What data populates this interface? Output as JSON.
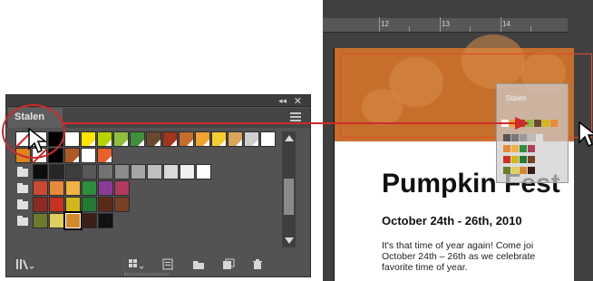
{
  "left_panel": {
    "tab_label": "Stalen",
    "collapse_glyph": "◂◂",
    "close_glyph": "✕",
    "swatch_rows": [
      {
        "folder": false,
        "swatches": [
          "none",
          "#ffffff",
          "#000000",
          "#ffffff|glob",
          "#ffe400|glob",
          "#b7d300|glob",
          "#8dbf3d|glob",
          "#3f8f3d|glob",
          "#6a4a2f|glob",
          "#a0341d|glob",
          "#c76c2c|glob",
          "#f0a32f|glob",
          "#f5cf2f|glob",
          "#d9a55a|glob",
          "#cfcfcf|glob",
          "#ffffff|glob"
        ]
      },
      {
        "folder": false,
        "swatches": [
          "#e0821f",
          "#ffffff|none",
          "#000000",
          "#b05a23|glob",
          "#ffffff|glob",
          "#e85f2c|glob"
        ]
      },
      {
        "folder": true,
        "swatches": [
          "#0d0d0d",
          "#262626",
          "#3f3f3f",
          "#595959",
          "#737373",
          "#8c8c8c",
          "#a6a6a6",
          "#bfbfbf",
          "#d9d9d9",
          "#efefef",
          "#ffffff"
        ]
      },
      {
        "folder": true,
        "swatches": [
          "#c94a30",
          "#e98a3a",
          "#f1b245",
          "#2b8f3e",
          "#8a3b98",
          "#b13a5d"
        ]
      },
      {
        "folder": true,
        "swatches": [
          "#8d2a20",
          "#c7311f",
          "#d2b61c",
          "#227a33",
          "#5c2a18",
          "#7a4023"
        ]
      },
      {
        "folder": true,
        "swatches": [
          "#6c7a2c",
          "#e0cf5c",
          "#d48a2c|sel",
          "#3a1f17",
          "#111111"
        ]
      }
    ],
    "bottom_icons": [
      "library-icon",
      "show-kinds-icon",
      "swatch-options-icon",
      "new-color-group-icon",
      "new-swatch-icon",
      "delete-swatch-icon"
    ]
  },
  "canvas": {
    "ruler_marks": [
      "12",
      "13",
      "14"
    ],
    "title": "Pumpkin Fest",
    "subtitle": "October 24th - 26th, 2010",
    "body_lines": [
      "It's that time of year again! Come joi",
      "October 24th – 26th as we celebrate",
      "favorite time of year."
    ],
    "ghost_panel_label": "Stalen"
  },
  "colors": {
    "accent_red": "#cf2a2a",
    "banner_orange": "#c66f2c",
    "panel_gray": "#535353"
  }
}
